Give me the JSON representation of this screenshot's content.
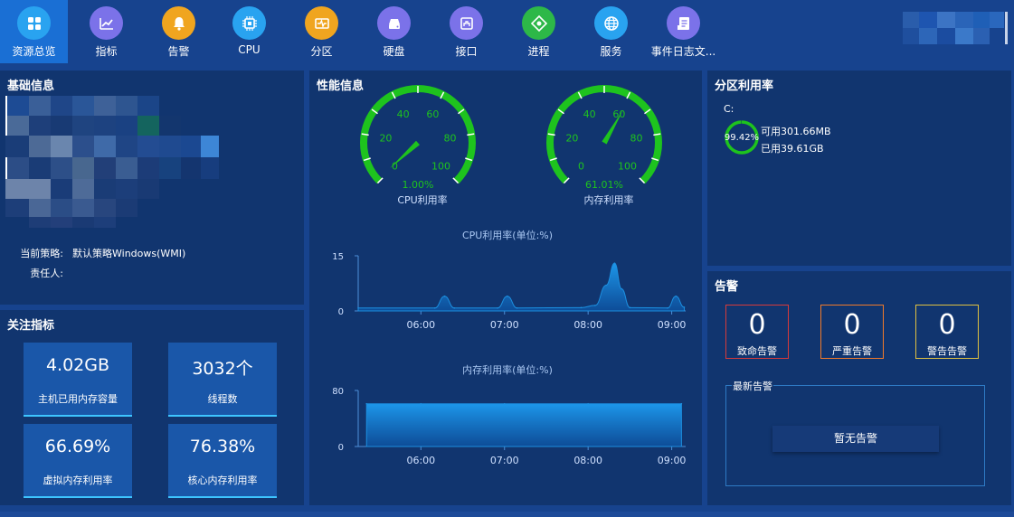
{
  "nav": {
    "items": [
      {
        "label": "资源总览",
        "icon": "grid-icon",
        "color": "#29a3f0",
        "active": true
      },
      {
        "label": "指标",
        "icon": "line-chart-icon",
        "color": "#7b72e9"
      },
      {
        "label": "告警",
        "icon": "bell-icon",
        "color": "#f0a51f"
      },
      {
        "label": "CPU",
        "icon": "chip-icon",
        "color": "#29a3f0"
      },
      {
        "label": "分区",
        "icon": "partition-icon",
        "color": "#f0a51f"
      },
      {
        "label": "硬盘",
        "icon": "disk-icon",
        "color": "#7b72e9"
      },
      {
        "label": "接口",
        "icon": "interface-icon",
        "color": "#7b72e9"
      },
      {
        "label": "进程",
        "icon": "process-icon",
        "color": "#2db848"
      },
      {
        "label": "服务",
        "icon": "globe-icon",
        "color": "#29a3f0"
      },
      {
        "label": "事件日志文...",
        "icon": "document-icon",
        "color": "#7b72e9"
      }
    ]
  },
  "basic_info": {
    "title": "基础信息",
    "policy_label": "当前策略:",
    "policy_value": "默认策略Windows(WMI)",
    "owner_label": "责任人:",
    "owner_value": ""
  },
  "focus_metrics": {
    "title": "关注指标",
    "cards": [
      {
        "value": "4.02GB",
        "label": "主机已用内存容量"
      },
      {
        "value": "3032个",
        "label": "线程数"
      },
      {
        "value": "66.69%",
        "label": "虚拟内存利用率"
      },
      {
        "value": "76.38%",
        "label": "核心内存利用率"
      }
    ]
  },
  "performance": {
    "title": "性能信息",
    "gauges": [
      {
        "label": "CPU利用率",
        "value": 1.0,
        "display": "1.00%",
        "ticks": [
          "0",
          "20",
          "40",
          "60",
          "80",
          "100"
        ]
      },
      {
        "label": "内存利用率",
        "value": 61.01,
        "display": "61.01%",
        "ticks": [
          "0",
          "20",
          "40",
          "60",
          "80",
          "100"
        ]
      }
    ],
    "colors": {
      "gauge": "#1ec31e",
      "line": "#1c8fe0",
      "axis": "#4d8fd8"
    }
  },
  "chart_data": [
    {
      "type": "area",
      "title": "CPU利用率(单位:%)",
      "xticks": [
        "06:00",
        "07:00",
        "08:00",
        "09:00"
      ],
      "yticks": [
        "0",
        "15"
      ],
      "ylim": [
        0,
        15
      ],
      "x_start": "05:15",
      "x_end": "09:10",
      "points": [
        [
          "05:15",
          0.8
        ],
        [
          "06:10",
          0.8
        ],
        [
          "06:17",
          4.0
        ],
        [
          "06:24",
          0.8
        ],
        [
          "06:55",
          0.8
        ],
        [
          "07:02",
          4.0
        ],
        [
          "07:09",
          0.8
        ],
        [
          "07:55",
          0.9
        ],
        [
          "08:05",
          1.5
        ],
        [
          "08:13",
          7.0
        ],
        [
          "08:19",
          13.0
        ],
        [
          "08:24",
          6.0
        ],
        [
          "08:30",
          0.9
        ],
        [
          "08:57",
          0.8
        ],
        [
          "09:03",
          4.0
        ],
        [
          "09:09",
          1.0
        ]
      ]
    },
    {
      "type": "area",
      "title": "内存利用率(单位:%)",
      "xticks": [
        "06:00",
        "07:00",
        "08:00",
        "09:00"
      ],
      "yticks": [
        "0",
        "80"
      ],
      "ylim": [
        0,
        80
      ],
      "x_start": "05:15",
      "x_end": "09:10",
      "points": [
        [
          "05:21",
          61.0
        ],
        [
          "06:00",
          61.0
        ],
        [
          "07:00",
          61.01
        ],
        [
          "08:00",
          61.01
        ],
        [
          "09:07",
          61.01
        ]
      ]
    }
  ],
  "partition": {
    "title": "分区利用率",
    "drive": "C:",
    "percent": 99.42,
    "percent_label": "99.42%",
    "available": "可用301.66MB",
    "used": "已用39.61GB"
  },
  "alarm": {
    "title": "告警",
    "boxes": [
      {
        "count": "0",
        "label": "致命告警",
        "border": "#d63a3a"
      },
      {
        "count": "0",
        "label": "严重告警",
        "border": "#f07a2a"
      },
      {
        "count": "0",
        "label": "警告告警",
        "border": "#e0c040"
      }
    ],
    "latest_title": "最新告警",
    "none_label": "暂无告警"
  }
}
